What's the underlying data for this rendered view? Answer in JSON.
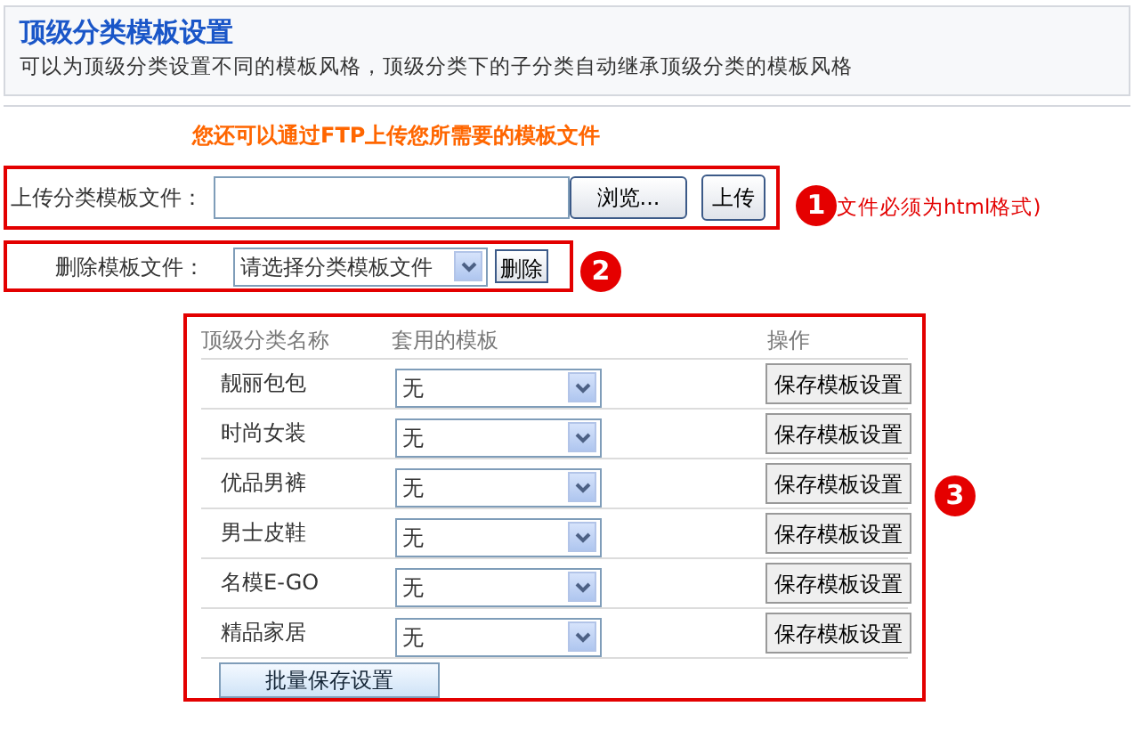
{
  "header": {
    "title": "顶级分类模板设置",
    "description": "可以为顶级分类设置不同的模板风格，顶级分类下的子分类自动继承顶级分类的模板风格"
  },
  "ftp_note": "您还可以通过FTP上传您所需要的模板文件",
  "upload": {
    "label": "上传分类模板文件：",
    "browse_button": "浏览...",
    "upload_button": "上传",
    "callout": "1",
    "note": "文件必须为html格式)"
  },
  "delete": {
    "label": "删除模板文件：",
    "select_value": "请选择分类模板文件",
    "delete_button": "删除",
    "callout": "2"
  },
  "table": {
    "callout": "3",
    "columns": [
      "顶级分类名称",
      "套用的模板",
      "操作"
    ],
    "rows": [
      {
        "name": "靓丽包包",
        "template": "无",
        "action": "保存模板设置"
      },
      {
        "name": "时尚女装",
        "template": "无",
        "action": "保存模板设置"
      },
      {
        "name": "优品男裤",
        "template": "无",
        "action": "保存模板设置"
      },
      {
        "name": "男士皮鞋",
        "template": "无",
        "action": "保存模板设置"
      },
      {
        "name": "名模E-GO",
        "template": "无",
        "action": "保存模板设置"
      },
      {
        "name": "精品家居",
        "template": "无",
        "action": "保存模板设置"
      }
    ],
    "batch_button": "批量保存设置"
  }
}
